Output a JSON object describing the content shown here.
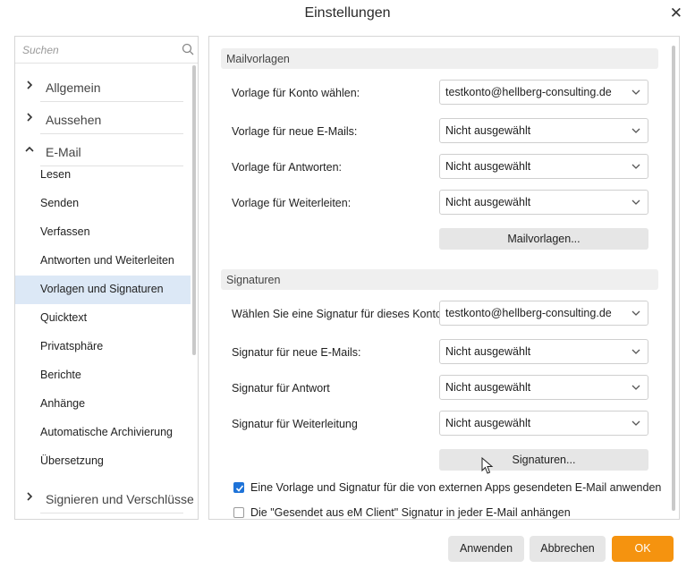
{
  "window": {
    "title": "Einstellungen"
  },
  "search": {
    "placeholder": "Suchen"
  },
  "nav": {
    "categories": [
      {
        "label": "Allgemein",
        "expanded": false
      },
      {
        "label": "Aussehen",
        "expanded": false
      },
      {
        "label": "E-Mail",
        "expanded": true
      },
      {
        "label": "Signieren und Verschlüsse",
        "expanded": false
      }
    ],
    "email_items": [
      "Lesen",
      "Senden",
      "Verfassen",
      "Antworten und Weiterleiten",
      "Vorlagen und Signaturen",
      "Quicktext",
      "Privatsphäre",
      "Berichte",
      "Anhänge",
      "Automatische Archivierung",
      "Übersetzung"
    ],
    "selected_item": "Vorlagen und Signaturen"
  },
  "mailvorlagen": {
    "header": "Mailvorlagen",
    "rows": [
      {
        "label": "Vorlage für Konto wählen:",
        "value": "testkonto@hellberg-consulting.de"
      },
      {
        "label": "Vorlage für neue E-Mails:",
        "value": "Nicht ausgewählt"
      },
      {
        "label": "Vorlage für Antworten:",
        "value": "Nicht ausgewählt"
      },
      {
        "label": "Vorlage für Weiterleiten:",
        "value": "Nicht ausgewählt"
      }
    ],
    "button": "Mailvorlagen..."
  },
  "signaturen": {
    "header": "Signaturen",
    "rows": [
      {
        "label": "Wählen Sie eine Signatur für dieses Konto:",
        "value": "testkonto@hellberg-consulting.de"
      },
      {
        "label": "Signatur für neue E-Mails:",
        "value": "Nicht ausgewählt"
      },
      {
        "label": "Signatur für Antwort",
        "value": "Nicht ausgewählt"
      },
      {
        "label": "Signatur für Weiterleitung",
        "value": "Nicht ausgewählt"
      }
    ],
    "button": "Signaturen..."
  },
  "options": [
    {
      "label": "Eine Vorlage und Signatur für die von externen Apps gesendeten E-Mail anwenden",
      "checked": true
    },
    {
      "label": "Die \"Gesendet aus eM Client\" Signatur in jeder E-Mail anhängen",
      "checked": false
    }
  ],
  "footer": {
    "apply": "Anwenden",
    "cancel": "Abbrechen",
    "ok": "OK"
  },
  "colors": {
    "accent": "#f5930f",
    "selection": "#dce8f6",
    "checkbox": "#1e73d8"
  }
}
